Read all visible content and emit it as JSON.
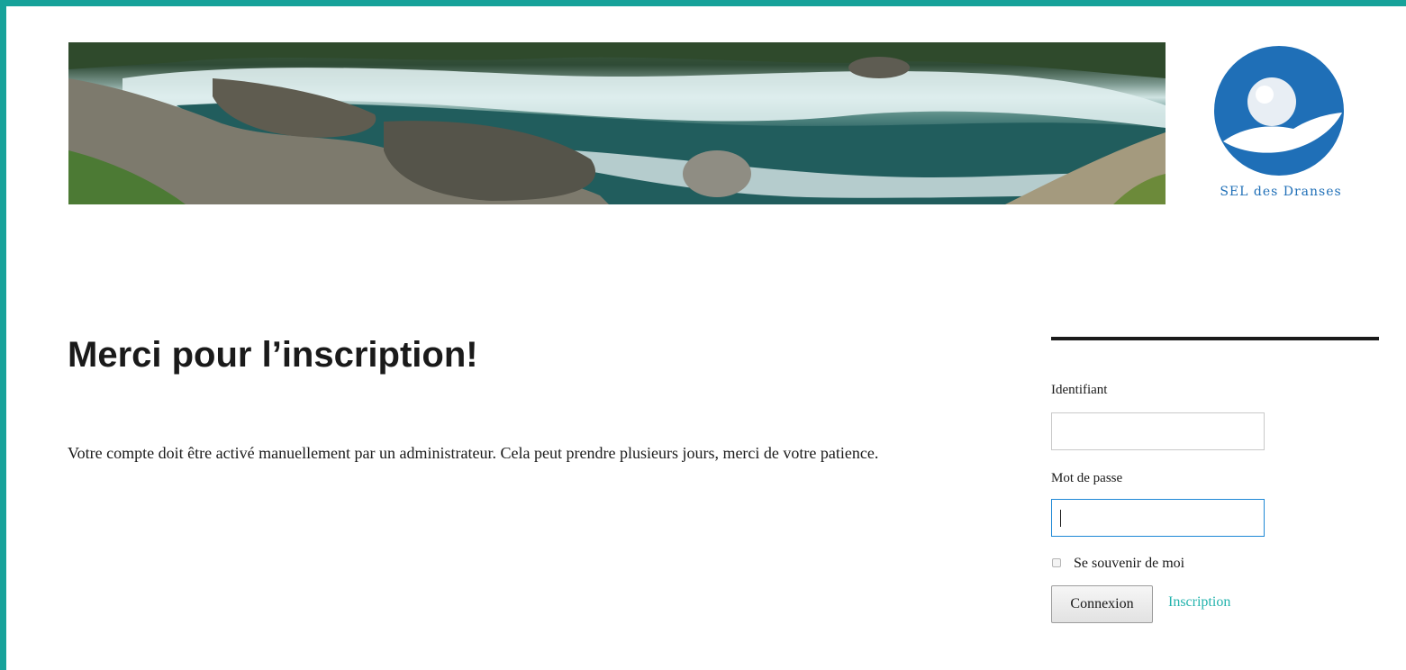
{
  "header": {
    "banner_image": "river-landscape-banner",
    "logo_name": "sel-des-dranses-logo",
    "logo_text": "SEL des Dranses"
  },
  "main": {
    "title": "Merci pour l’inscription!",
    "message": "Votre compte doit être activé manuellement par un administrateur. Cela peut prendre plusieurs jours, merci de votre patience."
  },
  "login_widget": {
    "username_label": "Identifiant",
    "username_value": "",
    "password_label": "Mot de passe",
    "password_value": "",
    "remember_label": "Se souvenir de moi",
    "remember_checked": false,
    "submit_label": "Connexion",
    "register_label": "Inscription"
  },
  "colors": {
    "frame": "#17a29a",
    "link": "#23b3ad",
    "focus": "#1e88d6",
    "logo_blue": "#1f6fb7"
  }
}
